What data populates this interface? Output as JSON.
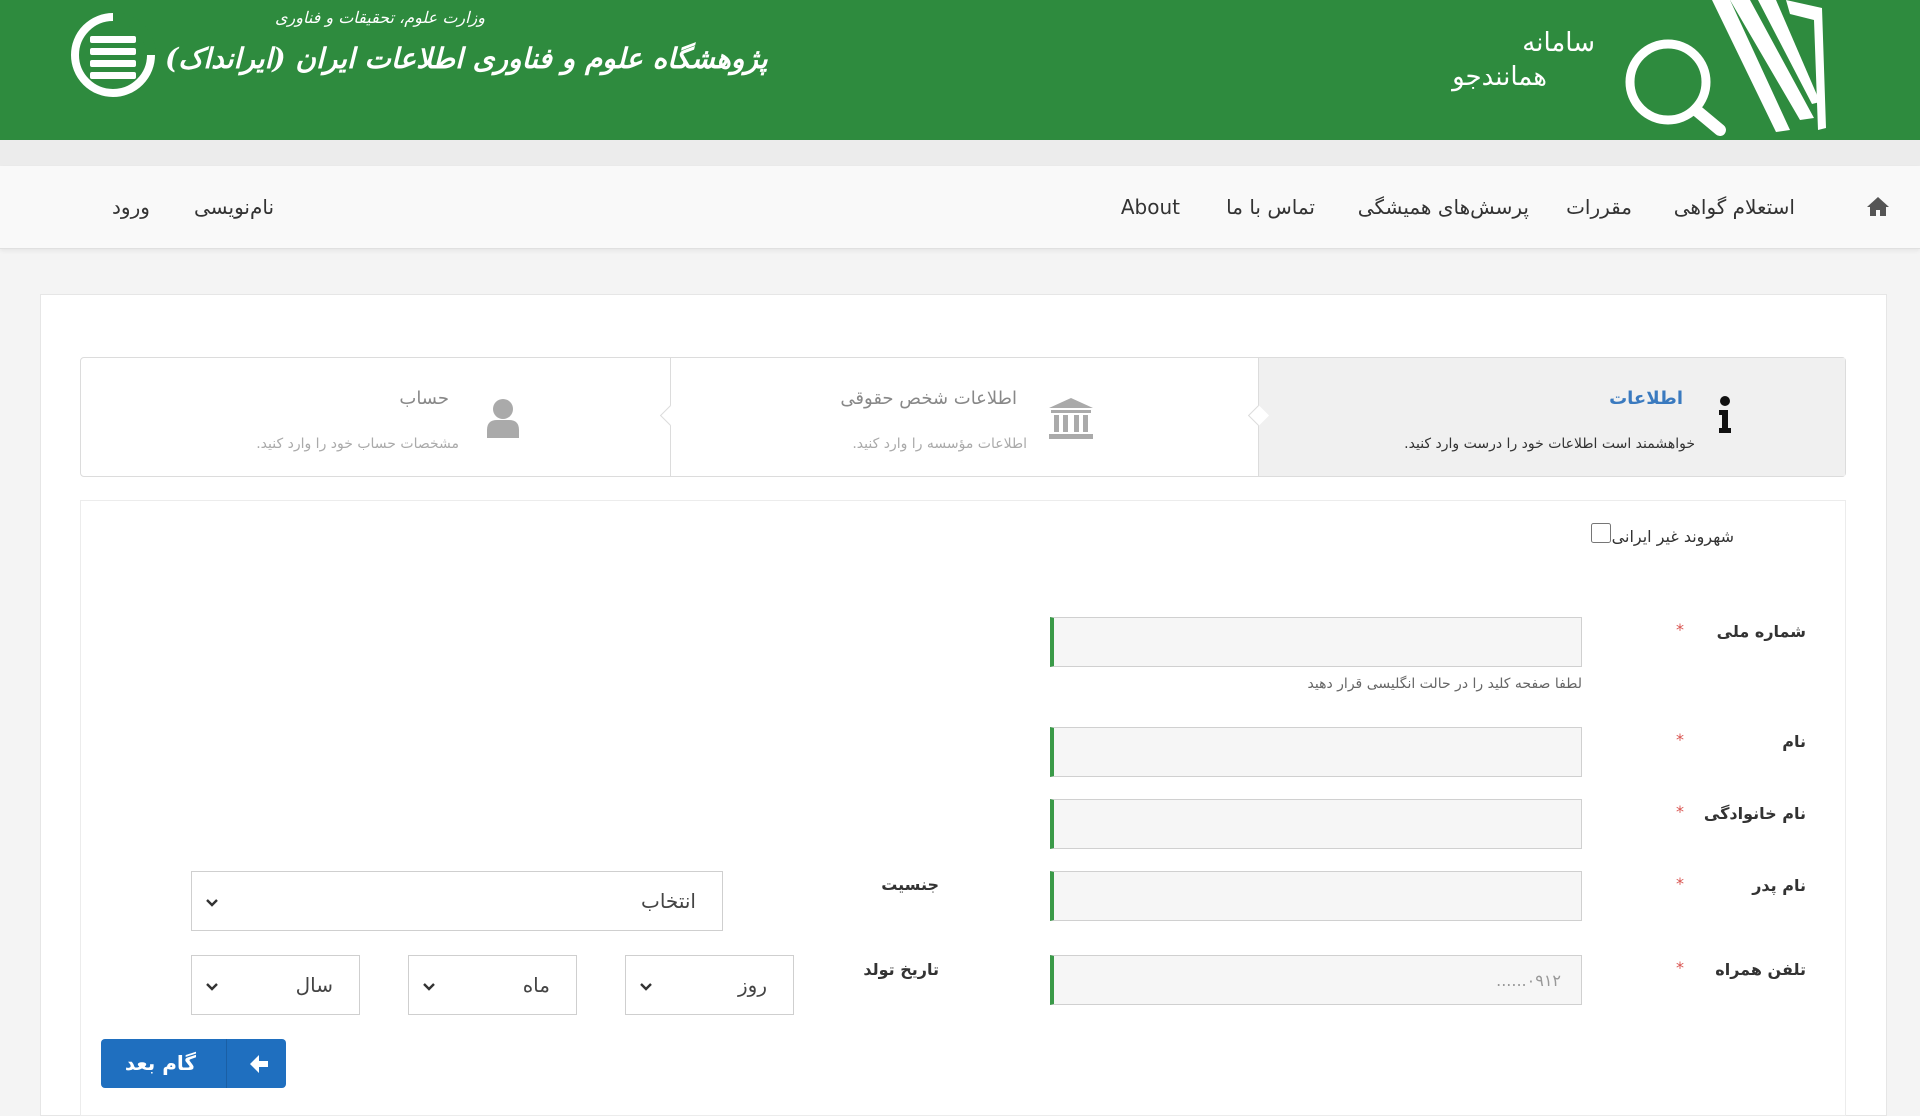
{
  "header": {
    "brand_line1": "سامانه",
    "brand_line2": "همانندجو",
    "ministry": "وزارت علوم، تحقیقات و فناوری",
    "org_name": "پژوهشگاه علوم و فناوری اطلاعات ایران (ایرانداک)"
  },
  "nav": {
    "home_icon": "home-icon",
    "items": [
      "استعلام گواهی",
      "مقررات",
      "پرسش‌های همیشگی",
      "تماس با ما",
      "About"
    ],
    "login": "ورود",
    "register": "نام‌نویسی"
  },
  "wizard": {
    "steps": [
      {
        "title": "اطلاعات",
        "desc": "خواهشمند است اطلاعات خود را درست وارد کنید.",
        "icon": "info-icon",
        "active": true
      },
      {
        "title": "اطلاعات شخص حقوقی",
        "desc": "اطلاعات مؤسسه را وارد کنید.",
        "icon": "institution-icon",
        "active": false
      },
      {
        "title": "حساب",
        "desc": "مشخصات حساب خود را  وارد کنید.",
        "icon": "user-icon",
        "active": false
      }
    ]
  },
  "form": {
    "non_iranian_label": "شهروند غیر ایرانی",
    "national_id_label": "شماره ملی",
    "national_id_value": "",
    "national_id_help": "لطفا صفحه کلید را در حالت انگلیسی قرار دهید",
    "first_name_label": "نام",
    "first_name_value": "",
    "last_name_label": "نام خانوادگی",
    "last_name_value": "",
    "father_name_label": "نام پدر",
    "father_name_value": "",
    "mobile_label": "تلفن همراه",
    "mobile_placeholder": "۰۹۱۲......",
    "mobile_value": "",
    "gender_label": "جنسیت",
    "gender_selected": "انتخاب",
    "birthdate_label": "تاریخ تولد",
    "day_selected": "روز",
    "month_selected": "ماه",
    "year_selected": "سال",
    "required_mark": "*"
  },
  "actions": {
    "next_label": "گام بعد"
  },
  "colors": {
    "header_green": "#2e8b3e",
    "active_step_title": "#3a7abf",
    "primary_button": "#1f6fbf",
    "required": "#d9534f",
    "input_accent": "#3a9a48"
  }
}
